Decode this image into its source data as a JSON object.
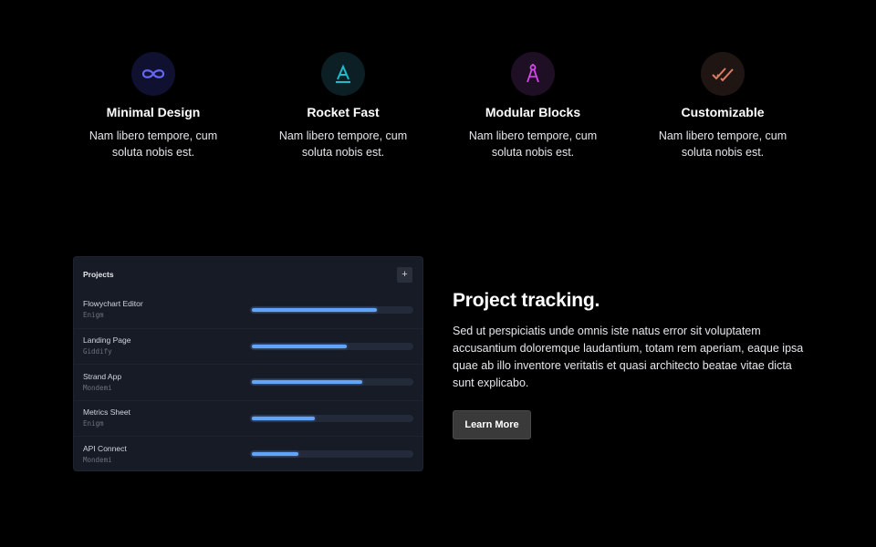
{
  "features": [
    {
      "icon": "infinity-icon",
      "title": "Minimal Design",
      "desc": "Nam libero tempore, cum soluta nobis est.",
      "color": "#6366f1",
      "bg": "#101030"
    },
    {
      "icon": "letter-a-icon",
      "title": "Rocket Fast",
      "desc": "Nam libero tempore, cum soluta nobis est.",
      "color": "#22b8cf",
      "bg": "#0b1f24"
    },
    {
      "icon": "compass-icon",
      "title": "Modular Blocks",
      "desc": "Nam libero tempore, cum soluta nobis est.",
      "color": "#d946ef",
      "bg": "#1e0f24"
    },
    {
      "icon": "double-check-icon",
      "title": "Customizable",
      "desc": "Nam libero tempore, cum soluta nobis est.",
      "color": "#e07a5f",
      "bg": "#1f1614"
    }
  ],
  "projects": {
    "title": "Projects",
    "add_label": "+",
    "rows": [
      {
        "name": "Flowychart Editor",
        "org": "Enigm",
        "progress": 0.78
      },
      {
        "name": "Landing Page",
        "org": "Giddify",
        "progress": 0.59
      },
      {
        "name": "Strand App",
        "org": "Mondemi",
        "progress": 0.69
      },
      {
        "name": "Metrics Sheet",
        "org": "Enigm",
        "progress": 0.39
      },
      {
        "name": "API Connect",
        "org": "Mondemi",
        "progress": 0.29
      }
    ],
    "bar_color": "#60a5fa"
  },
  "section": {
    "heading": "Project tracking.",
    "body": "Sed ut perspiciatis unde omnis iste natus error sit voluptatem accusantium doloremque laudantium, totam rem aperiam, eaque ipsa quae ab illo inventore veritatis et quasi architecto beatae vitae dicta sunt explicabo.",
    "button_label": "Learn More"
  }
}
